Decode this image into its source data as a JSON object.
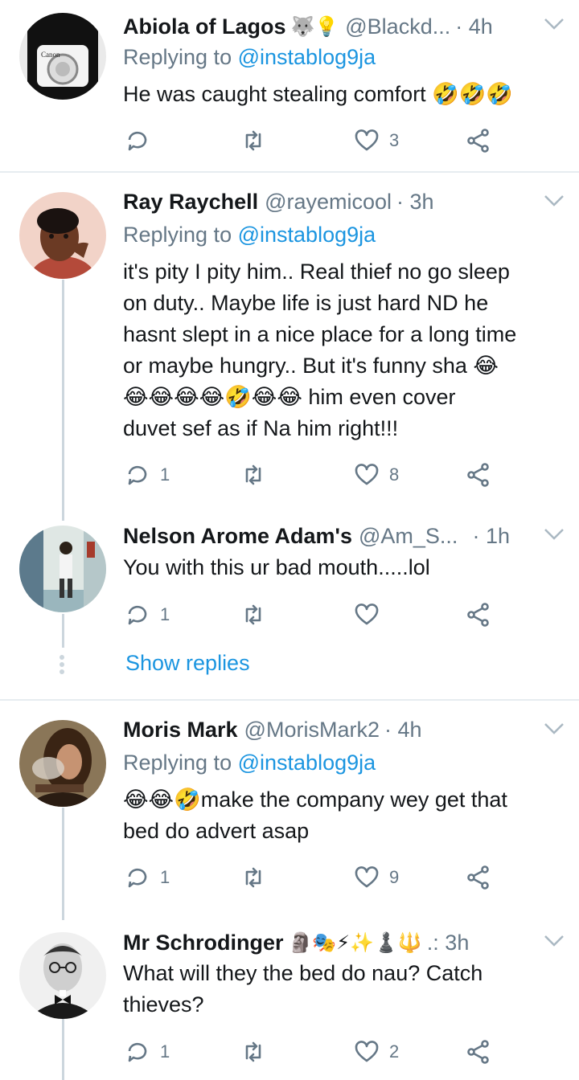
{
  "colors": {
    "accent": "#1b95e0",
    "muted": "#657786",
    "text": "#14171a",
    "divider": "#e6ecf0"
  },
  "tweets": [
    {
      "name": "Abiola of Lagos",
      "name_emoji": "🐺💡",
      "handle": "@Blackd...",
      "time": "· 4h",
      "replying_prefix": "Replying to",
      "replying_to": "@instablog9ja",
      "lines": [
        "He was caught stealing comfort 🤣🤣🤣"
      ],
      "actions": {
        "reply": "",
        "retweet": "",
        "like": "3"
      }
    },
    {
      "name": "Ray Raychell",
      "name_emoji": "",
      "handle": "@rayemicool",
      "time": "· 3h",
      "replying_prefix": "Replying to",
      "replying_to": "@instablog9ja",
      "lines": [
        "it's pity I pity him.. Real thief no go sleep",
        "on duty.. Maybe life is just hard ND he",
        "hasnt slept in a nice place for a long time",
        "or maybe hungry.. But it's funny sha 😂",
        "😂😂😂😂🤣😂😂 him even cover",
        "duvet sef as if Na him right!!!"
      ],
      "actions": {
        "reply": "1",
        "retweet": "",
        "like": "8"
      }
    },
    {
      "name": "Nelson Arome Adam's",
      "name_emoji": "",
      "handle": "@Am_S...",
      "time": "· 1h",
      "lines": [
        "You with this ur bad mouth.....lol"
      ],
      "actions": {
        "reply": "1",
        "retweet": "",
        "like": ""
      }
    },
    {
      "name": "Moris Mark",
      "name_emoji": "",
      "handle": "@MorisMark2",
      "time": "· 4h",
      "replying_prefix": "Replying to",
      "replying_to": "@instablog9ja",
      "lines": [
        "😂😂🤣make the company wey get that",
        "bed do advert asap"
      ],
      "actions": {
        "reply": "1",
        "retweet": "",
        "like": "9"
      }
    },
    {
      "name": "Mr Schrodinger",
      "name_emoji": "🗿🎭⚡✨♟️🔱",
      "handle": "",
      "time": ".: 3h",
      "lines": [
        "What will they the bed do nau? Catch",
        "thieves?"
      ],
      "actions": {
        "reply": "1",
        "retweet": "",
        "like": "2"
      }
    }
  ],
  "show_replies": "Show replies",
  "avatar_texts": {
    "canon": "Canon"
  }
}
